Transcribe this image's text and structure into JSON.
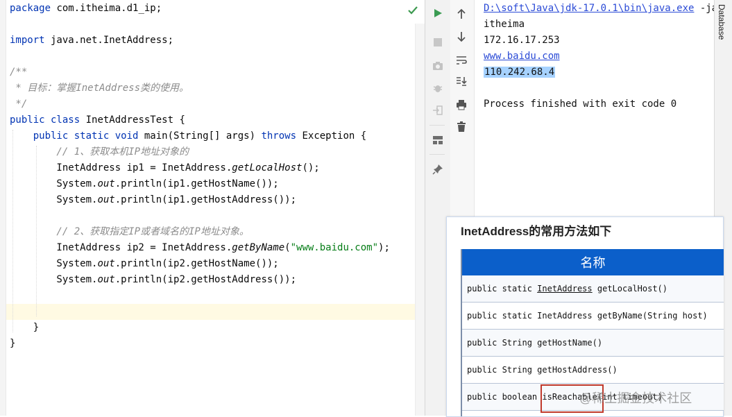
{
  "editor": {
    "lines": {
      "l1_kw": "package",
      "l1_rest": " com.itheima.d1_ip;",
      "l3_kw": "import",
      "l3_rest": " java.net.InetAddress;",
      "l5": "/**",
      "l6": " * 目标：掌握InetAddress类的使用。",
      "l7": " */",
      "l8_kw": "public class",
      "l8_rest": " InetAddressTest {",
      "l9_kw1": "    public static void",
      "l9_mid": " main(String[] args) ",
      "l9_kw2": "throws",
      "l9_rest": " Exception {",
      "l10": "        // 1、获取本机IP地址对象的",
      "l11_a": "        InetAddress ip1 = InetAddress.",
      "l11_b": "getLocalHost",
      "l11_c": "();",
      "l12_a": "        System.",
      "l12_b": "out",
      "l12_c": ".println(ip1.getHostName());",
      "l13_a": "        System.",
      "l13_b": "out",
      "l13_c": ".println(ip1.getHostAddress());",
      "l15": "        // 2、获取指定IP或者域名的IP地址对象。",
      "l16_a": "        InetAddress ip2 = InetAddress.",
      "l16_b": "getByName",
      "l16_c": "(",
      "l16_d": "\"www.baidu.com\"",
      "l16_e": ");",
      "l17_a": "        System.",
      "l17_b": "out",
      "l17_c": ".println(ip2.getHostName());",
      "l18_a": "        System.",
      "l18_b": "out",
      "l18_c": ".println(ip2.getHostAddress());",
      "l21": "    }",
      "l22": "}"
    }
  },
  "console": {
    "cmd_path": "D:\\soft\\Java\\jdk-17.0.1\\bin\\java.exe",
    "cmd_rest": " -ja",
    "out1": "itheima",
    "out2": "172.16.17.253",
    "out3": "www.baidu.com",
    "out4": "110.242.68.4",
    "out5": "Process finished with exit code 0"
  },
  "right_strip": {
    "database_label": "Database"
  },
  "slide": {
    "title": "InetAddress的常用方法如下",
    "header": "名称",
    "rows": [
      {
        "a": "public static ",
        "b": "InetAddress",
        "c": " getLocalHost()"
      },
      {
        "a": "public static InetAddress getByName(String host)",
        "b": "",
        "c": ""
      },
      {
        "a": "public String getHostName()",
        "b": "",
        "c": ""
      },
      {
        "a": "public String getHostAddress()",
        "b": "",
        "c": ""
      },
      {
        "a": "public boolean isReachable(int timeout)",
        "b": "",
        "c": ""
      }
    ]
  },
  "watermark": "@稀土掘金技术社区",
  "icons": [
    "check-icon",
    "run-icon",
    "stop-icon",
    "camera-icon",
    "debug-icon",
    "login-icon",
    "layout-icon",
    "pin-icon",
    "up-arrow-icon",
    "down-arrow-icon",
    "soft-wrap-icon",
    "scroll-end-icon",
    "print-icon",
    "trash-icon"
  ],
  "colors": {
    "keyword": "#0033b3",
    "comment": "#8c8c8c",
    "string": "#067d17",
    "link": "#2a4ad6",
    "table_header": "#0b5fca",
    "highlight": "#c0392b"
  }
}
